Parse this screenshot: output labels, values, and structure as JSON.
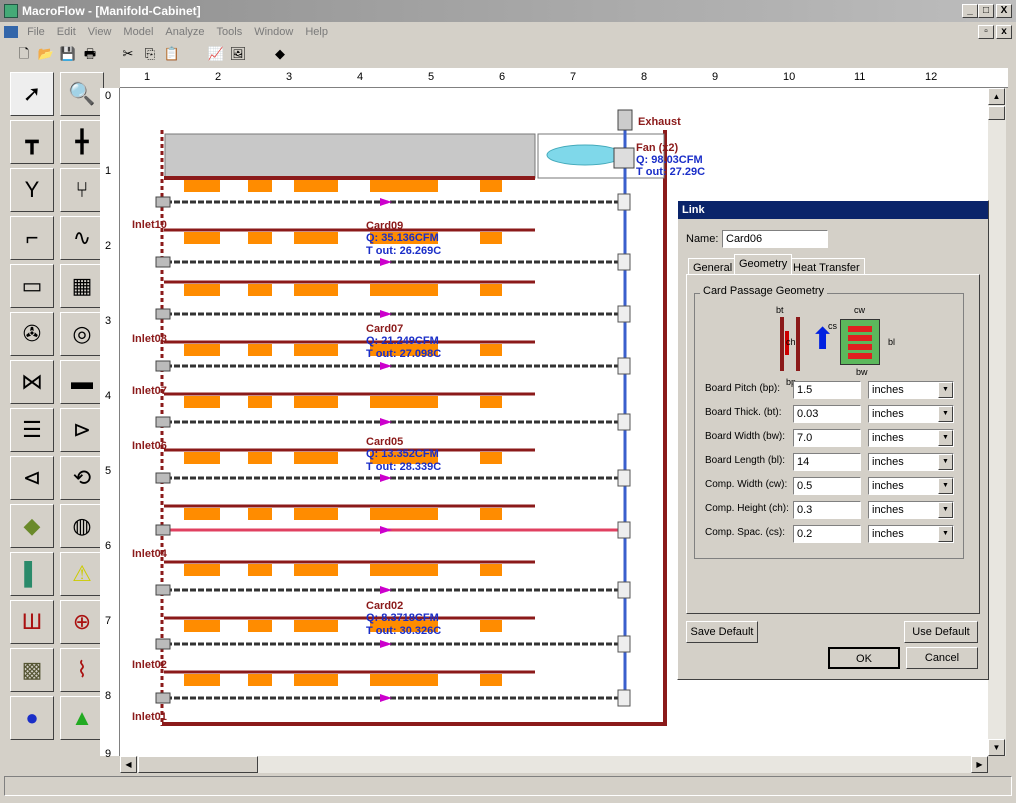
{
  "window": {
    "title": "MacroFlow - [Manifold-Cabinet]",
    "min": "_",
    "max": "□",
    "close": "X"
  },
  "menu": [
    "File",
    "Edit",
    "View",
    "Model",
    "Analyze",
    "Tools",
    "Window",
    "Help"
  ],
  "ruler": {
    "top": [
      "1",
      "2",
      "3",
      "4",
      "5",
      "6",
      "7",
      "8",
      "9",
      "10",
      "11",
      "12"
    ],
    "left": [
      "0",
      "1",
      "2",
      "3",
      "4",
      "5",
      "6",
      "7",
      "8",
      "9"
    ]
  },
  "diagram": {
    "exhaust": "Exhaust",
    "fan": {
      "name": "Fan (x2)",
      "q": "Q: 98.03CFM",
      "t": "T out: 27.29C"
    },
    "inlets": [
      "Inlet10",
      "Inlet08",
      "Inlet07",
      "Inlet06",
      "Inlet04",
      "Inlet02",
      "Inlet01"
    ],
    "cards": [
      {
        "name": "Card09",
        "q": "Q: 35.136CFM",
        "t": "T out: 26.269C"
      },
      {
        "name": "Card07",
        "q": "Q: 21.249CFM",
        "t": "T out: 27.098C"
      },
      {
        "name": "Card05",
        "q": "Q: 13.352CFM",
        "t": "T out: 28.339C"
      },
      {
        "name": "Card02",
        "q": "Q: 8.3718CFM",
        "t": "T out: 30.326C"
      }
    ]
  },
  "dialog": {
    "title": "Link",
    "name_label": "Name:",
    "name_value": "Card06",
    "tabs": [
      "General",
      "Geometry",
      "Heat Transfer"
    ],
    "group": "Card Passage Geometry",
    "diagram_labels": {
      "bt": "bt",
      "ch": "ch",
      "bp": "bp",
      "cw": "cw",
      "cs": "cs",
      "bl": "bl",
      "bw": "bw"
    },
    "fields": [
      {
        "label": "Board Pitch (bp):",
        "value": "1.5",
        "unit": "inches"
      },
      {
        "label": "Board Thick. (bt):",
        "value": "0.03",
        "unit": "inches"
      },
      {
        "label": "Board Width (bw):",
        "value": "7.0",
        "unit": "inches"
      },
      {
        "label": "Board Length (bl):",
        "value": "14",
        "unit": "inches"
      },
      {
        "label": "Comp. Width (cw):",
        "value": "0.5",
        "unit": "inches"
      },
      {
        "label": "Comp. Height (ch):",
        "value": "0.3",
        "unit": "inches"
      },
      {
        "label": "Comp. Spac. (cs):",
        "value": "0.2",
        "unit": "inches"
      }
    ],
    "save_default": "Save Default",
    "use_default": "Use Default",
    "ok": "OK",
    "cancel": "Cancel"
  },
  "colors": {
    "wall": "#8b1a1a",
    "duct": "#3a5fcd",
    "component": "#ff8c00",
    "flow": "#cc00cc"
  }
}
